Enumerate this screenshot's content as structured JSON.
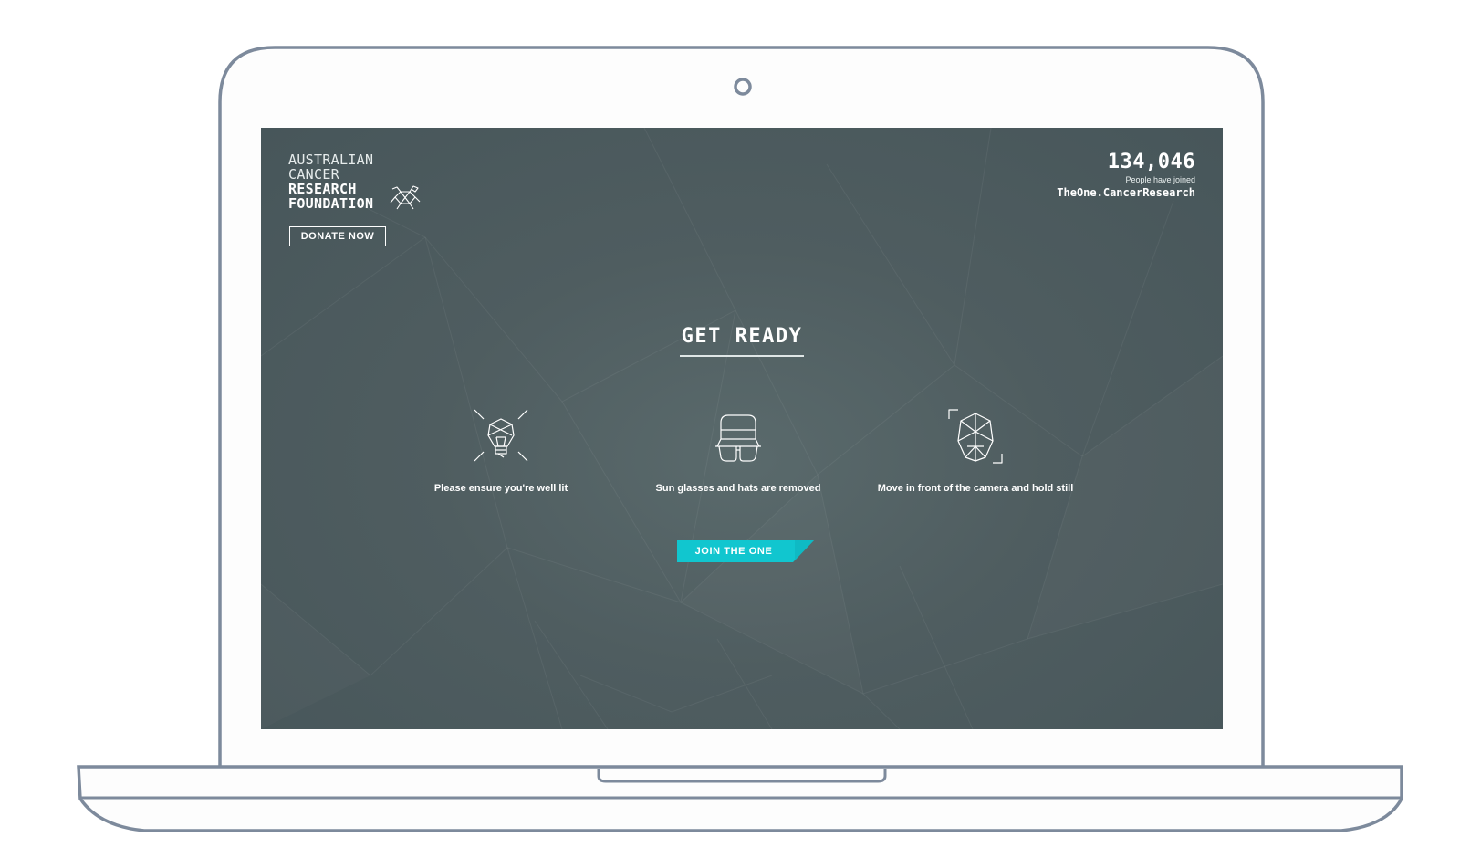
{
  "colors": {
    "screen_bg": "#4f5d60",
    "accent": "#11c6cf",
    "frame": "#7d8a9c"
  },
  "logo": {
    "lines": [
      "AUSTRALIAN",
      "CANCER",
      "RESEARCH",
      "FOUNDATION"
    ],
    "icon": "crab-icon"
  },
  "donate_label": "DONATE NOW",
  "counter": {
    "value": "134,046",
    "caption": "People have joined",
    "site": "TheOne.CancerResearch"
  },
  "heading": "GET READY",
  "steps": [
    {
      "icon": "lightbulb-icon",
      "label": "Please ensure you're well lit"
    },
    {
      "icon": "hat-glasses-icon",
      "label": "Sun glasses and hats are removed"
    },
    {
      "icon": "face-scan-icon",
      "label": "Move in front of the camera and hold still"
    }
  ],
  "cta_label": "JOIN THE ONE"
}
